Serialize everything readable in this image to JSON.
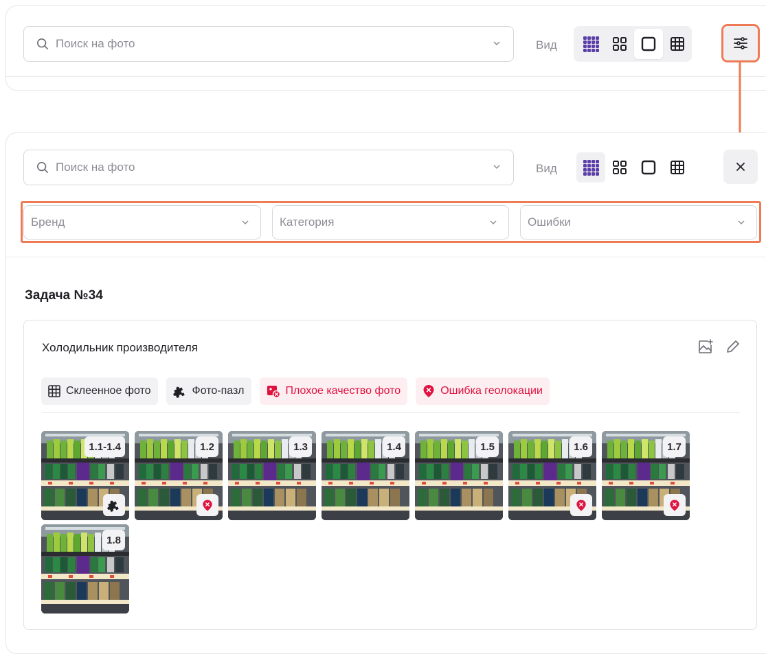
{
  "top_bar": {
    "search_placeholder": "Поиск на фото",
    "view_label": "Вид"
  },
  "expanded_bar": {
    "search_placeholder": "Поиск на фото",
    "view_label": "Вид",
    "filters": [
      {
        "label": "Бренд"
      },
      {
        "label": "Категория"
      },
      {
        "label": "Ошибки"
      }
    ]
  },
  "colors": {
    "highlight": "#ef7a56",
    "error": "#e0123f",
    "view_icon_active": "#5b3fa8"
  },
  "task": {
    "title": "Задача №34",
    "equipment": {
      "title": "Холодильник производителя",
      "tags": [
        {
          "label": "Склеенное фото",
          "icon": "grid-icon",
          "error": false
        },
        {
          "label": "Фото-пазл",
          "icon": "puzzle-icon",
          "error": false
        },
        {
          "label": "Плохое качество фото",
          "icon": "bad-photo-icon",
          "error": true
        },
        {
          "label": "Ошибка геолокации",
          "icon": "geo-error-icon",
          "error": true
        }
      ],
      "photos": [
        {
          "label": "1.1-1.4",
          "mark": "puzzle-icon"
        },
        {
          "label": "1.2",
          "mark": "geo-error-icon"
        },
        {
          "label": "1.3",
          "mark": null
        },
        {
          "label": "1.4",
          "mark": null
        },
        {
          "label": "1.5",
          "mark": null
        },
        {
          "label": "1.6",
          "mark": "geo-error-icon"
        },
        {
          "label": "1.7",
          "mark": "geo-error-icon"
        },
        {
          "label": "1.8",
          "mark": null
        }
      ]
    }
  }
}
